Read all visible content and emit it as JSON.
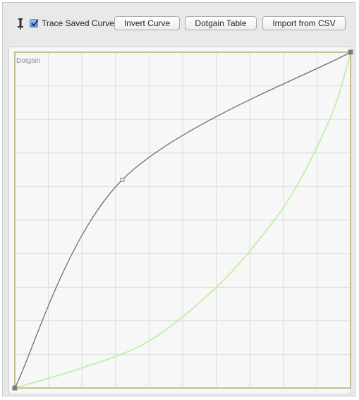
{
  "toolbar": {
    "tool_icon": "pin-icon",
    "trace_checkbox_checked": true,
    "trace_label": "Trace Saved Curve",
    "invert_label": "Invert Curve",
    "dotgain_table_label": "Dotgain Table",
    "import_csv_label": "Import from CSV"
  },
  "graph": {
    "label": "Dotgain",
    "grid_divisions": 10,
    "colors": {
      "border": "#c8bf8f",
      "grid": "#dcdcdc",
      "edited_curve": "#6f6f6f",
      "saved_curve": "#b6f09f",
      "point": "#888888"
    },
    "edited_curve": {
      "points": [
        [
          0,
          0
        ],
        [
          0.32,
          0.62
        ],
        [
          1,
          1
        ]
      ]
    },
    "saved_curve": {
      "points": [
        [
          0,
          0
        ],
        [
          0.2,
          0.06
        ],
        [
          0.4,
          0.14
        ],
        [
          0.6,
          0.3
        ],
        [
          0.75,
          0.47
        ],
        [
          0.85,
          0.62
        ],
        [
          0.95,
          0.83
        ],
        [
          1,
          1
        ]
      ]
    }
  }
}
